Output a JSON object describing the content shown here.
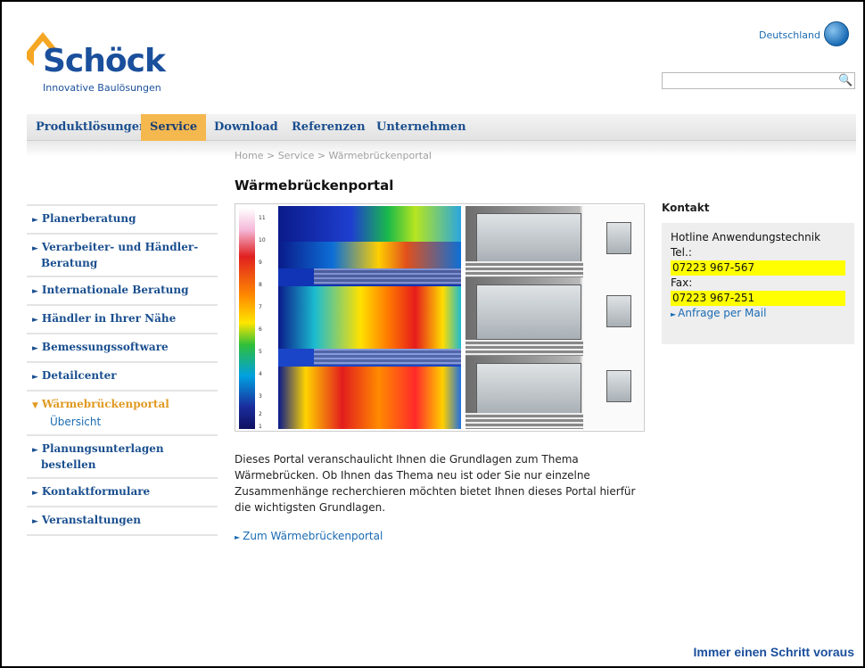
{
  "header": {
    "logo_text": "Schöck",
    "logo_tagline": "Innovative Baulösungen",
    "country": "Deutschland",
    "search_placeholder": ""
  },
  "nav": {
    "items": [
      {
        "label": "Produktlösungen",
        "active": false
      },
      {
        "label": "Service",
        "active": true
      },
      {
        "label": "Download",
        "active": false
      },
      {
        "label": "Referenzen",
        "active": false
      },
      {
        "label": "Unternehmen",
        "active": false
      }
    ]
  },
  "breadcrumb": "Home > Service > Wärmebrückenportal",
  "page_title": "Wärmebrückenportal",
  "sidebar": {
    "items": [
      {
        "label": "Planerberatung"
      },
      {
        "label": "Verarbeiter- und Händler-Beratung"
      },
      {
        "label": "Internationale Beratung"
      },
      {
        "label": "Händler in Ihrer Nähe"
      },
      {
        "label": "Bemessungssoftware"
      },
      {
        "label": "Detailcenter"
      },
      {
        "label": "Wärmebrückenportal",
        "sub": "Übersicht"
      },
      {
        "label": "Planungsunterlagen bestellen"
      },
      {
        "label": "Kontaktformulare"
      },
      {
        "label": "Veranstaltungen"
      }
    ]
  },
  "thermo_scale": [
    "11",
    "10",
    "9",
    "8",
    "7",
    "6",
    "5",
    "4",
    "3",
    "2",
    "1"
  ],
  "intro_text": "Dieses Portal veranschaulicht Ihnen die Grundlagen zum Thema Wärmebrücken. Ob Ihnen das Thema neu ist oder Sie nur einzelne Zusammenhänge recherchieren möchten bietet Ihnen dieses Portal hierfür die wichtigsten Grundlagen.",
  "portal_link": "Zum Wärmebrückenportal",
  "contact": {
    "heading": "Kontakt",
    "hotline": "Hotline Anwendungstechnik",
    "tel_label": "Tel.:",
    "tel": "07223 967-567",
    "fax_label": "Fax:",
    "fax": "07223 967-251",
    "mail_link": "Anfrage per Mail"
  },
  "slogan": "Immer einen Schritt voraus",
  "colors": {
    "brand_blue": "#1a4f9c",
    "accent_orange": "#f5b84f",
    "highlight_yellow": "#ffff00",
    "link_blue": "#1a6bb3"
  }
}
